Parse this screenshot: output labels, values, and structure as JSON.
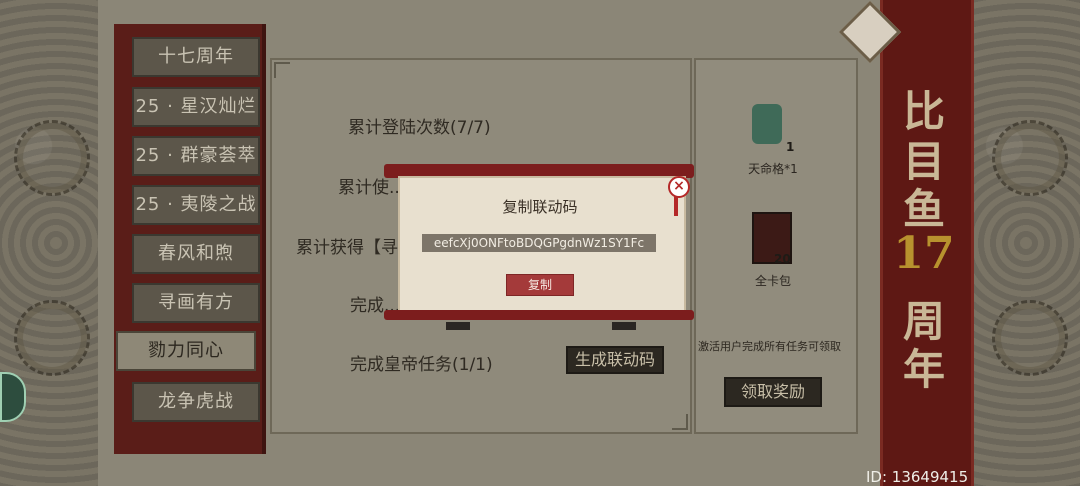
{
  "tabs": [
    {
      "label": "十七周年",
      "active": false
    },
    {
      "label": "25 · 星汉灿烂",
      "active": false
    },
    {
      "label": "25 · 群豪荟萃",
      "active": false
    },
    {
      "label": "25 · 夷陵之战",
      "active": false
    },
    {
      "label": "春风和煦",
      "active": false
    },
    {
      "label": "寻画有方",
      "active": false
    },
    {
      "label": "勠力同心",
      "active": true
    },
    {
      "label": "龙争虎战",
      "active": false
    }
  ],
  "tasks": [
    {
      "text": "累计登陆次数(7/7)"
    },
    {
      "text": "累计使..."
    },
    {
      "text": "累计获得【寻..."
    },
    {
      "text": "完成..."
    },
    {
      "text": "完成皇帝任务(1/1)"
    }
  ],
  "generate_button_label": "生成联动码",
  "rewards": [
    {
      "name": "天命格*1",
      "count": "1",
      "icon": "jade-seal-icon"
    },
    {
      "name": "全卡包",
      "count": "20",
      "icon": "card-pack-icon"
    }
  ],
  "reward_note": "激活用户完成所有任务可领取",
  "claim_button_label": "领取奖励",
  "banner": {
    "line1": "比",
    "line2": "目",
    "line3": "鱼",
    "number": "17",
    "line4": "周",
    "line5": "年"
  },
  "modal": {
    "title": "复制联动码",
    "code": "eefcXj0ONFtoBDQGPgdnWz1SY1Fc",
    "copy_label": "复制"
  },
  "user_id": "ID: 13649415",
  "colors": {
    "accent_red": "#7c1d1d",
    "panel": "#8b8677",
    "gold": "#b8922e"
  }
}
